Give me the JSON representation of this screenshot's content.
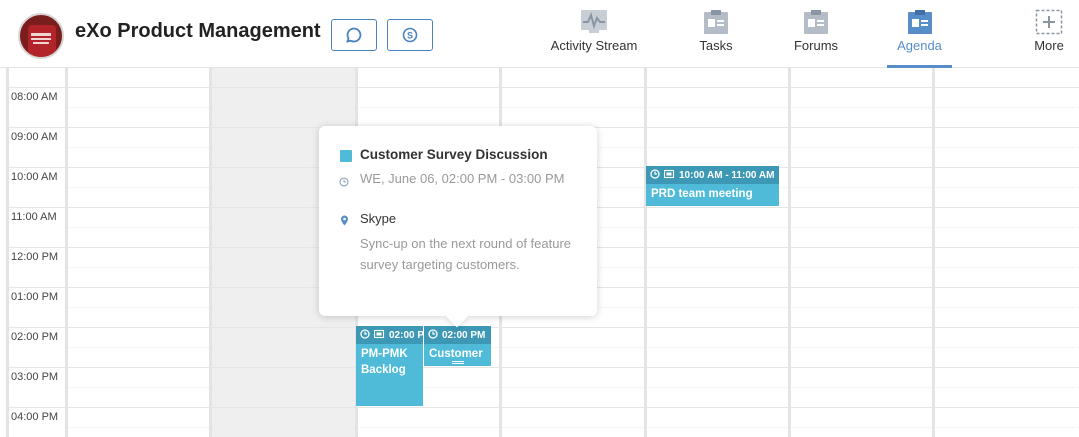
{
  "header": {
    "space_title": "eXo Product Management",
    "avatar_icon": "space-avatar-icon",
    "buttons": [
      {
        "icon": "chat-bubble-icon"
      },
      {
        "icon": "skype-icon"
      }
    ],
    "nav": [
      {
        "label": "Activity Stream",
        "icon": "activity-stream-icon",
        "active": false
      },
      {
        "label": "Tasks",
        "icon": "tasks-icon",
        "active": false
      },
      {
        "label": "Forums",
        "icon": "forums-icon",
        "active": false
      },
      {
        "label": "Agenda",
        "icon": "agenda-icon",
        "active": true
      },
      {
        "label": "More",
        "icon": "plus-icon",
        "active": false
      }
    ],
    "accent_color": "#578dc9"
  },
  "calendar": {
    "time_labels": [
      "08:00 AM",
      "09:00 AM",
      "10:00 AM",
      "11:00 AM",
      "12:00 PM",
      "01:00 PM",
      "02:00 PM",
      "03:00 PM",
      "04:00 PM"
    ],
    "events": [
      {
        "time": "10:00 AM - 11:00 AM",
        "title": "PRD team meeting"
      },
      {
        "time": "02:00 PM",
        "title": "PM-PMK Backlog"
      },
      {
        "time": "02:00 PM",
        "title": "Customer"
      }
    ],
    "event_color": "#4fbbd9",
    "event_header_color": "#3c98b5"
  },
  "popover": {
    "title": "Customer Survey Discussion",
    "time": "WE, June 06, 02:00 PM - 03:00 PM",
    "location": "Skype",
    "description": "Sync-up on the next round of feature survey targeting customers."
  }
}
